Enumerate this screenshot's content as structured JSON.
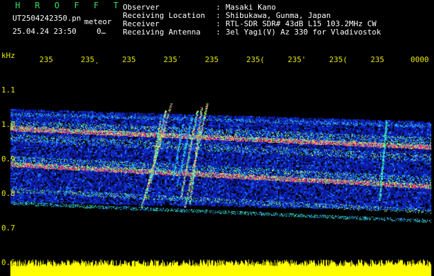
{
  "header": {
    "logo": "H R O F F T",
    "filename": "UT2504242350.pn",
    "filename_suffix": "meteor",
    "datetime": "25.04.24 23:50",
    "extra": "0…",
    "fields": [
      {
        "label": "Observer",
        "value": "Masaki Kano"
      },
      {
        "label": "Receiving Location",
        "value": "Shibukawa, Gunma, Japan"
      },
      {
        "label": "Receiver",
        "value": "RTL-SDR SDR# 43dB L15 103.2MHz CW"
      },
      {
        "label": "Receiving Antenna",
        "value": "3el Yagi(V) Az 330 for Vladivostok"
      }
    ]
  },
  "axis": {
    "unit": "kHz",
    "y_ticks": [
      "1.1",
      "1.0",
      "0.9",
      "0.8",
      "0.7",
      "0.6"
    ],
    "x_ticks": [
      "235",
      "235̧",
      "235",
      "235̇",
      "235",
      "235(",
      "235'",
      "235(",
      "235",
      "0000"
    ]
  },
  "colors": {
    "background": "#000000",
    "noise": "#0a1aa0",
    "signal_red": "#ff3080",
    "signal_green": "#40ff80",
    "signal_yellow": "#ffff40",
    "bottom_band": "#ffff00",
    "text_yellow": "#e8e800",
    "logo_green": "#39e060"
  }
}
